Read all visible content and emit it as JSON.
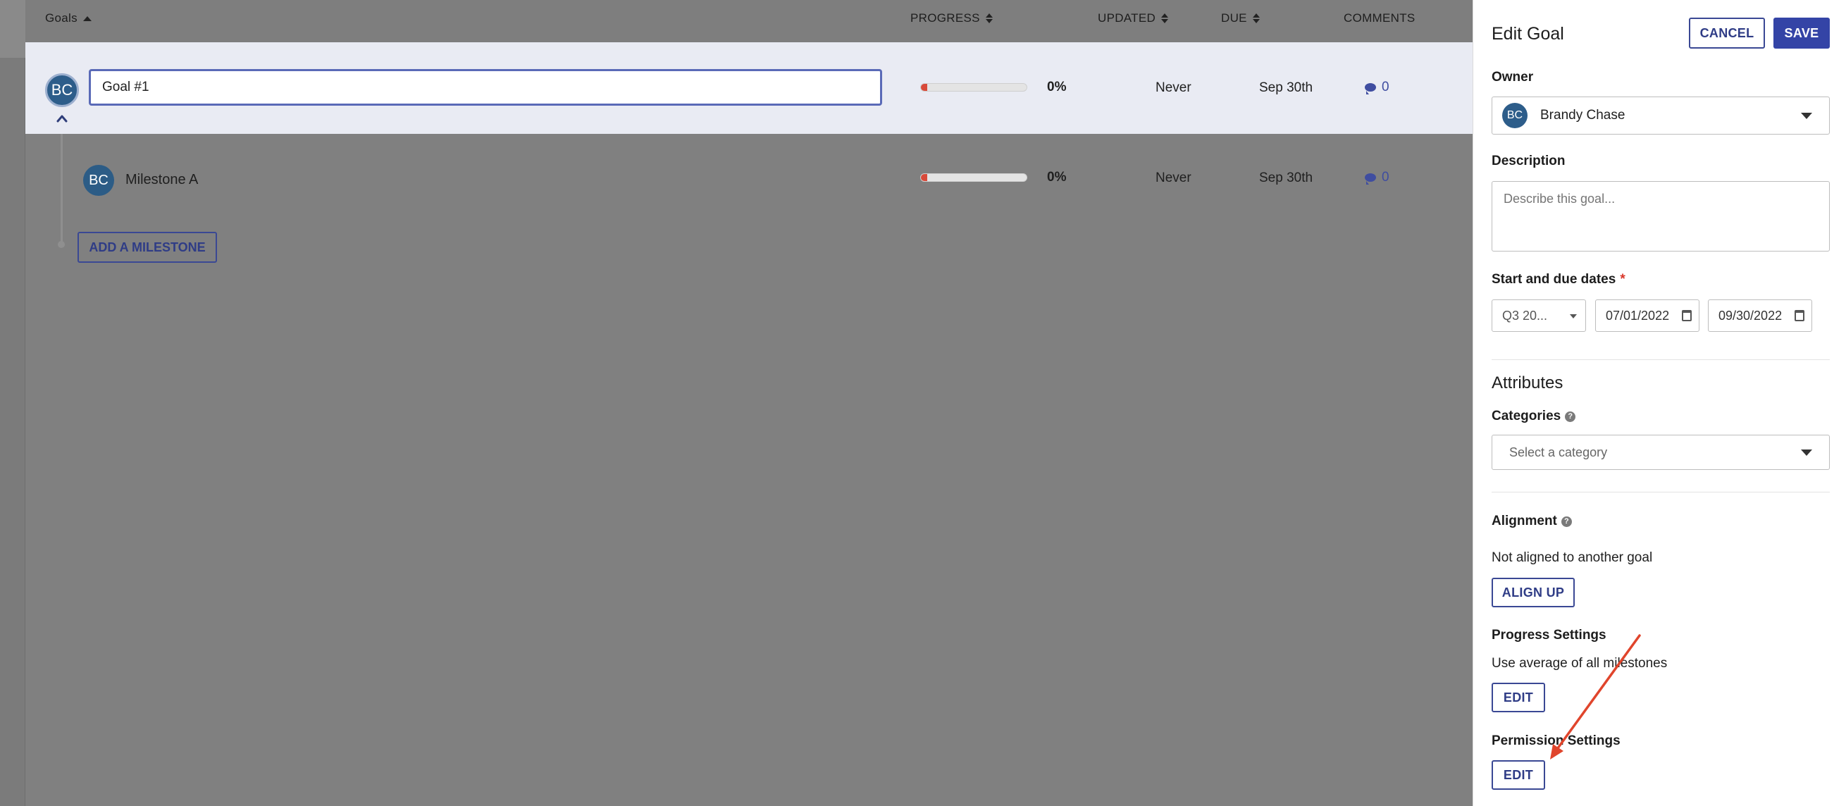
{
  "table": {
    "headers": {
      "goals": "Goals",
      "progress": "PROGRESS",
      "updated": "UPDATED",
      "due": "DUE",
      "comments": "COMMENTS"
    },
    "goal": {
      "avatar": "BC",
      "name": "Goal #1",
      "progress": 0,
      "progress_label": "0%",
      "updated": "Never",
      "due": "Sep 30th",
      "comments": "0"
    },
    "milestones": [
      {
        "avatar": "BC",
        "name": "Milestone A",
        "progress": 0,
        "progress_label": "0%",
        "updated": "Never",
        "due": "Sep 30th",
        "comments": "0"
      }
    ],
    "add_milestone_label": "ADD A MILESTONE"
  },
  "panel": {
    "title": "Edit Goal",
    "cancel_label": "CANCEL",
    "save_label": "SAVE",
    "owner_label": "Owner",
    "owner_avatar": "BC",
    "owner_name": "Brandy Chase",
    "description_label": "Description",
    "description_placeholder": "Describe this goal...",
    "dates_label": "Start and due dates",
    "required_mark": "*",
    "period": "Q3 20...",
    "start_date": "07/01/2022",
    "due_date": "09/30/2022",
    "attributes_title": "Attributes",
    "categories_label": "Categories",
    "categories_placeholder": "Select a category",
    "alignment_label": "Alignment",
    "alignment_text": "Not aligned to another goal",
    "align_up_label": "ALIGN UP",
    "progress_settings_label": "Progress Settings",
    "progress_settings_text": "Use average of all milestones",
    "progress_edit_label": "EDIT",
    "permission_settings_label": "Permission Settings",
    "permission_edit_label": "EDIT",
    "help_glyph": "?"
  },
  "colors": {
    "accent": "#3444a6",
    "avatar": "#2d5d8a",
    "annotation_arrow": "#e0452c",
    "progress_fill": "#d84a3a"
  }
}
